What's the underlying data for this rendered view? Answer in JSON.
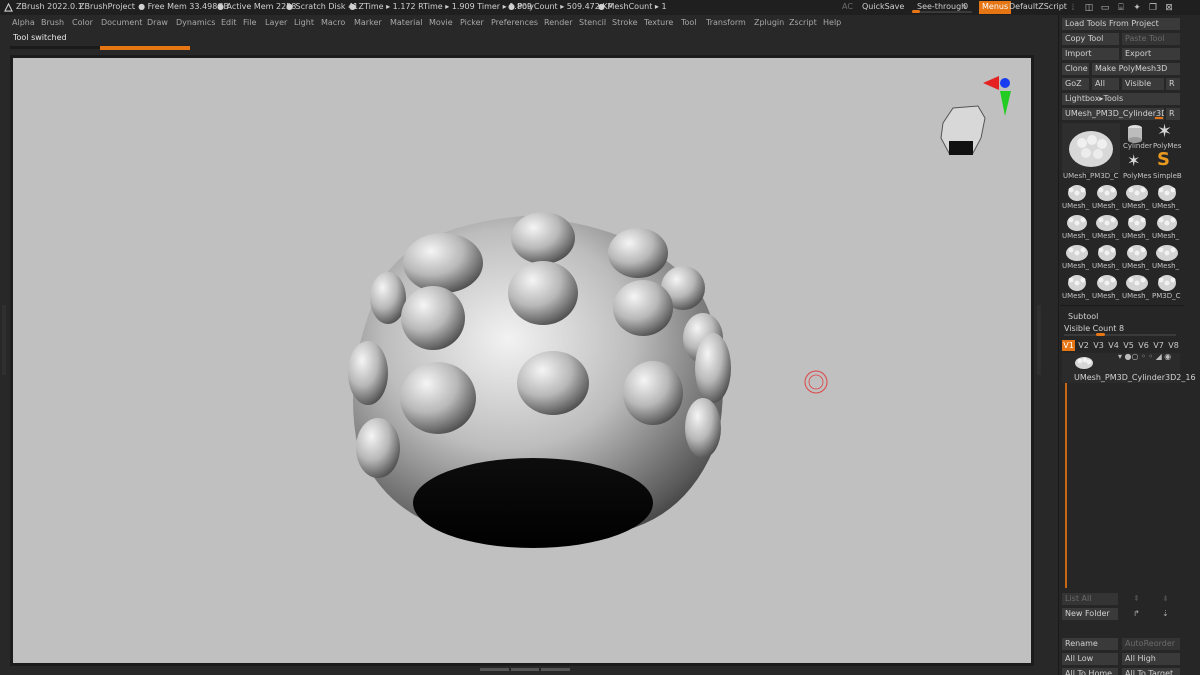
{
  "titlebar": {
    "app": "ZBrush 2022.0.1",
    "project": "ZBrushProject",
    "free_mem": ". ● Free Mem 33.498GB",
    "active_mem": "● Active Mem 2258",
    "scratch_disk": "● Scratch Disk 41",
    "ztime": "● ZTime ▸ 1.172 RTime ▸ 1.909 Timer ▸ 1.809",
    "polycount": "● PolyCount ▸ 509.472 KP",
    "meshcount": "● MeshCount ▸ 1",
    "ac": "AC",
    "quicksave": "QuickSave",
    "seethrough": "See-through",
    "seethrough_value": "0",
    "menus": "Menus",
    "script": "DefaultZScript"
  },
  "menubar": {
    "items": [
      "Alpha",
      "Brush",
      "Color",
      "Document",
      "Draw",
      "Dynamics",
      "Edit",
      "File",
      "Layer",
      "Light",
      "Macro",
      "Marker",
      "Material",
      "Movie",
      "Picker",
      "Preferences",
      "Render",
      "Stencil",
      "Stroke",
      "Texture",
      "Tool",
      "Transform",
      "Zplugin",
      "Zscript",
      "Help"
    ]
  },
  "status": {
    "message": "Tool switched",
    "progress": 0.5
  },
  "rpanel": {
    "load_tools": "Load Tools From Project",
    "copy_tool": "Copy Tool",
    "paste_tool": "Paste Tool",
    "import": "Import",
    "export": "Export",
    "clone": "Clone",
    "make_polymesh": "Make PolyMesh3D",
    "goz": "GoZ",
    "all": "All",
    "visible": "Visible",
    "r": "R",
    "lightbox_tools": "Lightbox▸Tools",
    "current_tool": "UMesh_PM3D_Cylinder3D2_1",
    "current_r": "R",
    "big_thumb_label": "UMesh_PM3D_C",
    "cylinder_label": "Cylinder",
    "polymesh_label": "PolyMes",
    "polymesh2_label": "PolyMes",
    "simpleb_label": "SimpleB",
    "umesh_label": "UMesh_",
    "last_label": "PM3D_C",
    "subtool_title": "Subtool",
    "visible_count": "Visible Count 8",
    "versions": [
      "V1",
      "V2",
      "V3",
      "V4",
      "V5",
      "V6",
      "V7",
      "V8"
    ],
    "subtool_name": "UMesh_PM3D_Cylinder3D2_16",
    "list_all": "List All",
    "new_folder": "New Folder",
    "rename": "Rename",
    "autoreorder": "AutoReorder",
    "all_low": "All Low",
    "all_high": "All High",
    "all_to_home": "All To Home",
    "all_to_target": "All To Target"
  },
  "colors": {
    "accent": "#e67514",
    "canvas": "#c0c0c0",
    "panel": "#262626"
  }
}
